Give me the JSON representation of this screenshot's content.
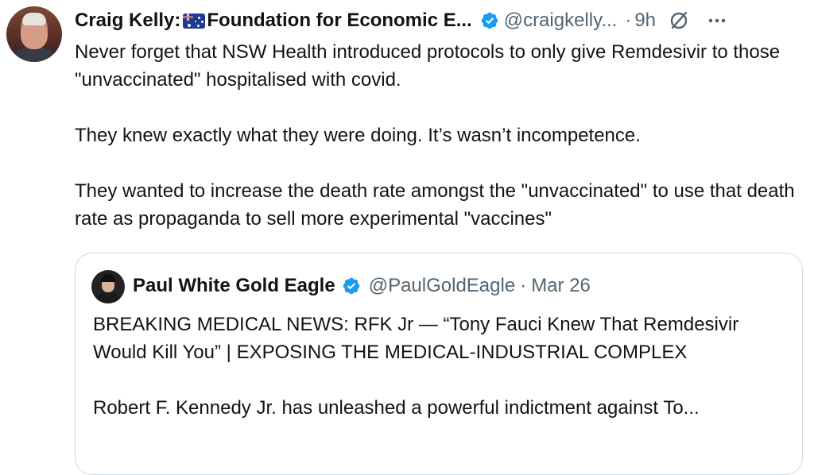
{
  "tweet": {
    "display_name": "Craig Kelly:",
    "display_name_suffix": "Foundation for Economic E...",
    "handle": "@craigkelly...",
    "separator": "·",
    "time": "9h",
    "body": "Never forget that NSW Health introduced protocols to only give Remdesivir to those \"unvaccinated\" hospitalised with covid.\n\nThey knew exactly what they were doing. It’s wasn’t incompetence.\n\nThey wanted to increase the death rate amongst the \"unvaccinated\" to use that death rate as propaganda to sell more experimental \"vaccines\"",
    "icons": [
      "avatar",
      "australian-flag-icon",
      "verified-badge-icon",
      "grok-icon",
      "more-icon"
    ],
    "colors": {
      "verified": "#1d9bf0",
      "secondary_text": "#536471",
      "primary_text": "#0f1419",
      "border": "#cfd9de"
    }
  },
  "quoted_tweet": {
    "display_name": "Paul White Gold Eagle",
    "handle": "@PaulGoldEagle",
    "separator": "·",
    "time": "Mar 26",
    "body": "BREAKING MEDICAL NEWS: RFK Jr — “Tony Fauci Knew That Remdesivir Would Kill You” | EXPOSING THE MEDICAL-INDUSTRIAL COMPLEX\n\nRobert F. Kennedy Jr. has unleashed a powerful indictment against To..."
  }
}
